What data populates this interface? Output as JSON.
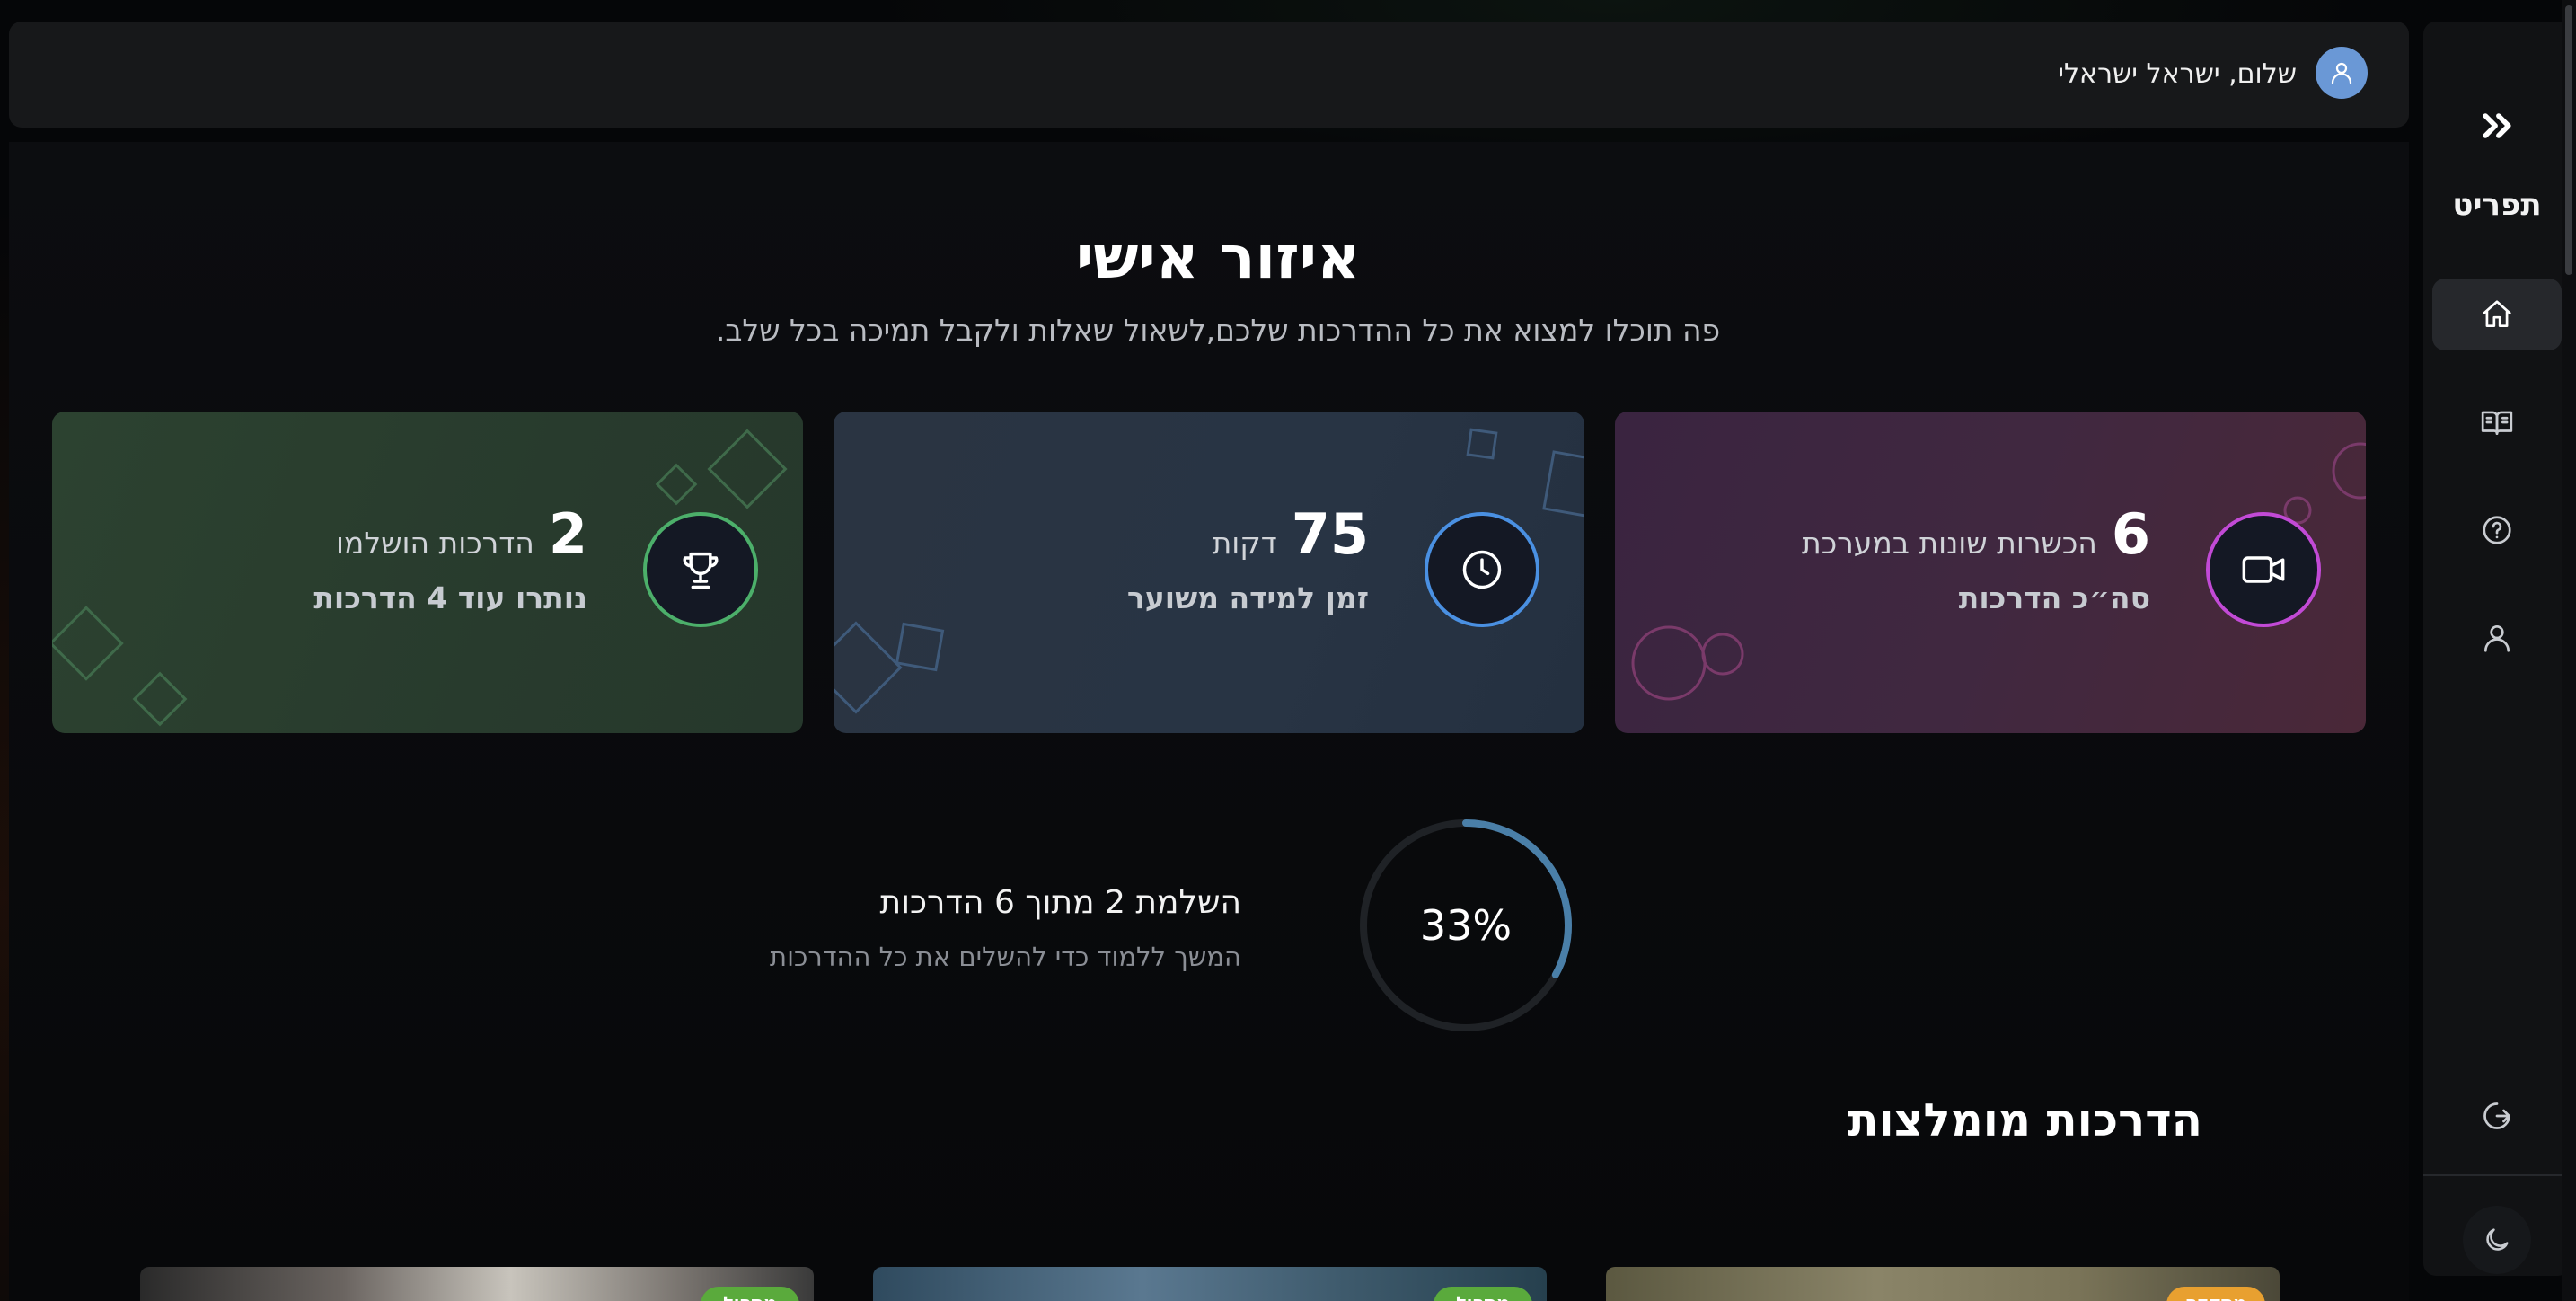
{
  "header": {
    "greeting": "שלום, ישראל ישראלי"
  },
  "sidebar": {
    "logo": "תפריט",
    "items": [
      {
        "name": "home",
        "icon": "home-icon",
        "active": true
      },
      {
        "name": "trainings",
        "icon": "book-open-icon",
        "active": false
      },
      {
        "name": "help",
        "icon": "help-circle-icon",
        "active": false
      },
      {
        "name": "profile",
        "icon": "user-icon",
        "active": false
      }
    ],
    "logout_icon": "logout-icon",
    "theme_icon": "moon-icon",
    "collapse_icon": "chevrons-right-icon"
  },
  "main": {
    "title": "איזור אישי",
    "subtitle": "פה תוכלו למצוא את כל ההדרכות שלכם,לשאול שאלות ולקבל תמיכה בכל שלב.",
    "stats": {
      "videos": {
        "number": "6",
        "unit": "הכשרות שונות במערכת",
        "desc": "סה״כ הדרכות",
        "icon": "video-icon",
        "accent": "#c24ad6"
      },
      "time": {
        "number": "75",
        "unit": "דקות",
        "desc": "זמן למידה משוער",
        "icon": "clock-icon",
        "accent": "#4a90e2"
      },
      "done": {
        "number": "2",
        "unit": "הדרכות הושלמו",
        "desc": "נותרו עוד 4 הדרכות",
        "icon": "trophy-icon",
        "accent": "#4caf6a"
      }
    },
    "progress": {
      "percent_label": "33%",
      "fraction": 0.33,
      "title": "השלמת 2 מתוך 6 הדרכות",
      "subtitle": "המשך ללמוד כדי להשלים את כל ההדרכות",
      "accent": "#4a7fa8"
    },
    "recommended": {
      "title": "הדרכות מומלצות",
      "cards": [
        {
          "badge": "מתקדם",
          "badge_color": "#e8a030"
        },
        {
          "badge": "מתחיל",
          "badge_color": "#5aaa3c"
        },
        {
          "badge": "מתחיל",
          "badge_color": "#5aaa3c"
        }
      ]
    }
  }
}
